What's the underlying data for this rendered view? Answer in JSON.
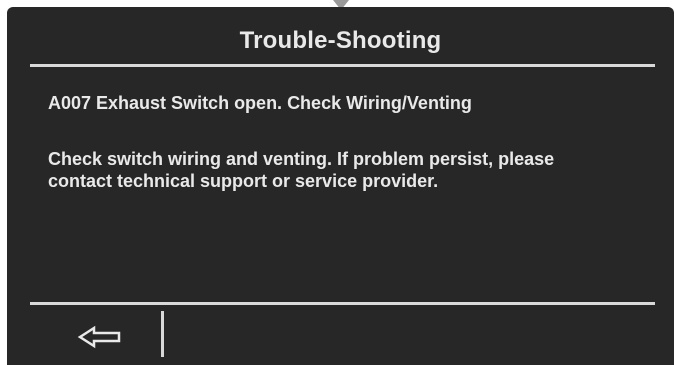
{
  "screen": {
    "title": "Trouble-Shooting",
    "error_line": "A007 Exhaust Switch open. Check Wiring/Venting",
    "detail_text": "Check switch wiring and venting. If problem persist, please contact technical support or service provider.",
    "background_color": "#272727",
    "text_color": "#e9e9e9"
  },
  "footer": {
    "back_icon": "left-arrow-outline-icon"
  }
}
